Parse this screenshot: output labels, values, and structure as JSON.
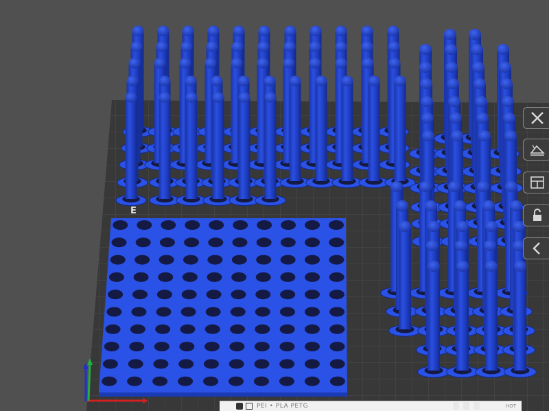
{
  "viewport": {
    "background": "#505050",
    "bed_color": "#3a3a3a",
    "model_color": "#1f3fc8",
    "plate_color": "#2a52e6"
  },
  "sidebar": {
    "items": [
      {
        "name": "close",
        "icon": "close-icon"
      },
      {
        "name": "auto-orient",
        "icon": "auto-orient-icon"
      },
      {
        "name": "arrange",
        "icon": "arrange-icon"
      },
      {
        "name": "lock",
        "icon": "lock-icon"
      },
      {
        "name": "collapse",
        "icon": "chevron-left-icon"
      }
    ]
  },
  "bed_label": "E",
  "status_bar": {
    "text": "PEI • PLA PETG",
    "right_text": "HOT"
  },
  "axes": {
    "x_color": "#d02020",
    "y_color": "#20b040",
    "z_color": "#2030d0"
  }
}
